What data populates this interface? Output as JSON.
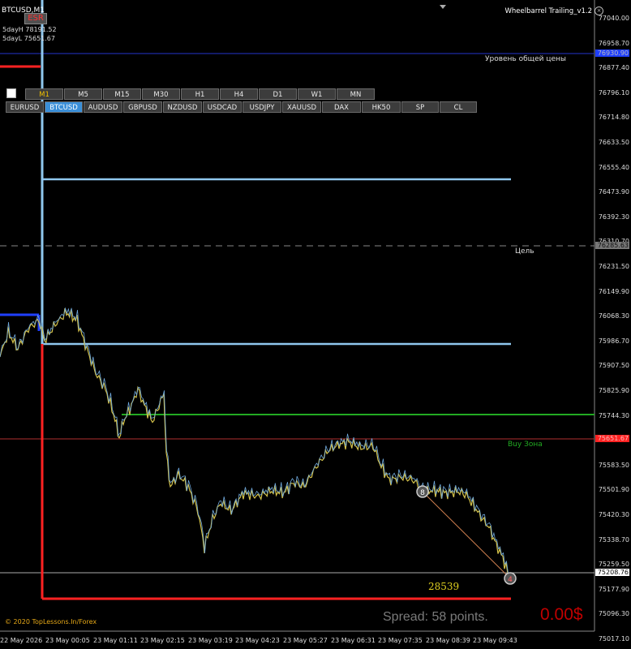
{
  "symbol_title": "BTCUSD,M1",
  "stats": {
    "high": "5dayH 78191.52",
    "low": "5dayL 75651.67"
  },
  "esr_label": "ESR",
  "indicator": {
    "name": "Wheelbarrel Trailing_v1.2",
    "close_glyph": "×"
  },
  "timeframes": [
    "M1",
    "M5",
    "M15",
    "M30",
    "H1",
    "H4",
    "D1",
    "W1",
    "MN"
  ],
  "active_timeframe": "M1",
  "symbols": [
    "EURUSD",
    "BTCUSD",
    "AUDUSD",
    "GBPUSD",
    "NZDUSD",
    "USDCAD",
    "USDJPY",
    "XAUUSD",
    "DAX",
    "HK50",
    "SP",
    "CL"
  ],
  "active_symbol": "BTCUSD",
  "price_axis": [
    "77040.00",
    "76958.70",
    "76877.40",
    "76796.10",
    "76714.80",
    "76633.50",
    "76555.40",
    "76473.90",
    "76392.30",
    "76310.70",
    "76231.50",
    "76149.90",
    "76068.30",
    "75986.70",
    "75907.50",
    "75825.90",
    "75744.30",
    "75662.70",
    "75583.50",
    "75501.90",
    "75420.30",
    "75338.70",
    "75259.50",
    "75177.90",
    "75096.30",
    "75017.10"
  ],
  "price_tags": {
    "top_blue": "76930.90",
    "target": "76285.63",
    "buy_zone": "75651.67",
    "current": "75208.76"
  },
  "line_labels": {
    "common_price": "Уровень общей цены",
    "target": "Цель",
    "buy_zone": "Buy Зона"
  },
  "time_axis": [
    "22 May 2026",
    "23 May 00:05",
    "23 May 01:11",
    "23 May 02:15",
    "23 May 03:19",
    "23 May 04:23",
    "23 May 05:27",
    "23 May 06:31",
    "23 May 07:35",
    "23 May 08:39",
    "23 May 09:43"
  ],
  "counter": "28539",
  "copyright": "© 2020 TopLessons.In/Forex",
  "spread": "Spread: 58 points.",
  "profit": "0.00$",
  "markers": {
    "start": "8",
    "end": "4"
  },
  "colors": {
    "accent": "#3a8fd8",
    "level": "#8fc7ee",
    "buy": "#22aa22",
    "stop": "#ff2222",
    "price": "#d4c24a"
  }
}
